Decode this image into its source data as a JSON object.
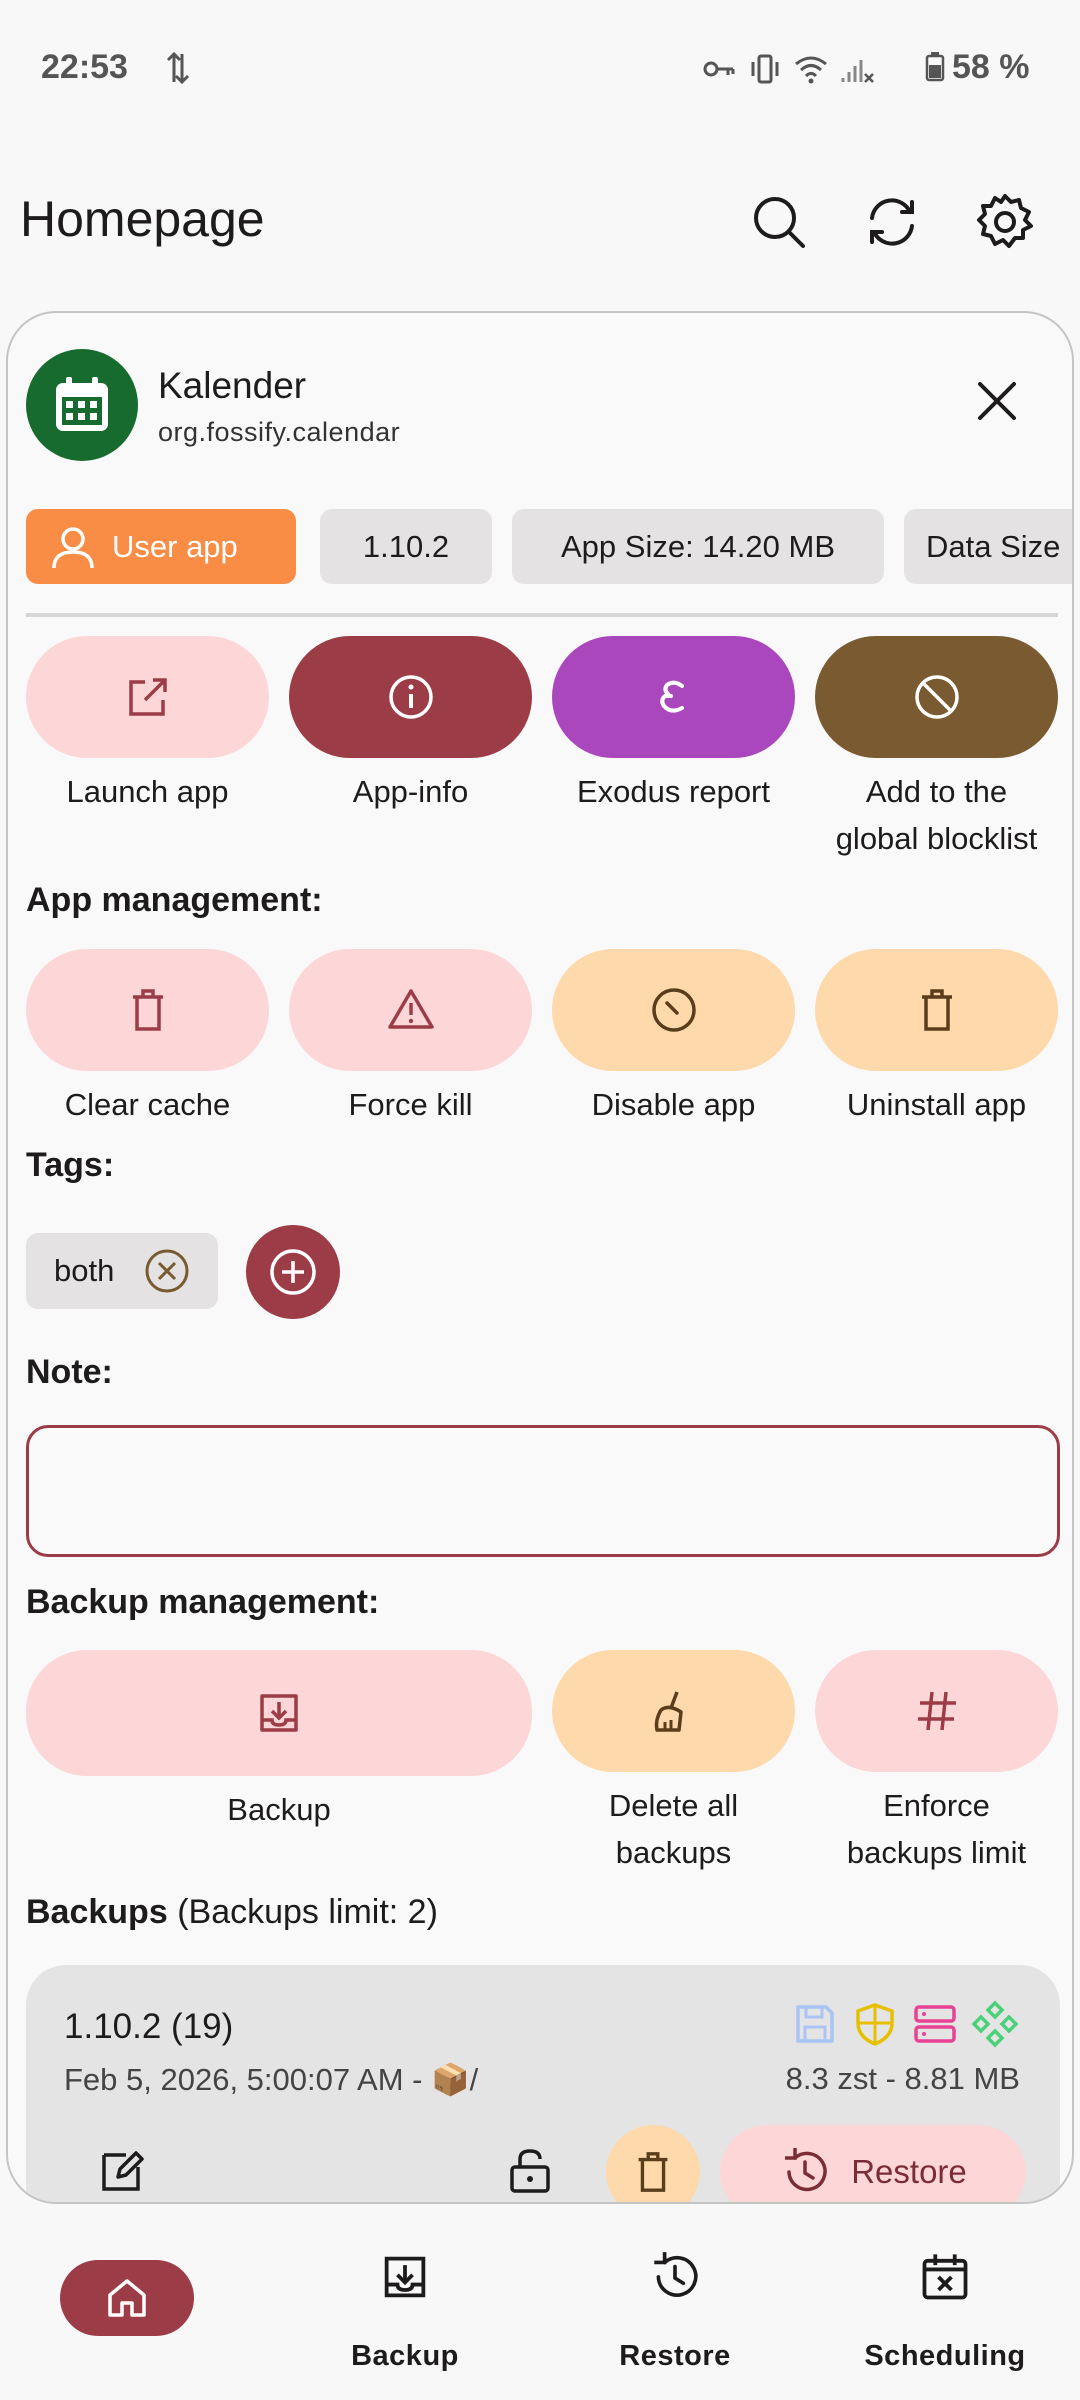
{
  "status_bar": {
    "time": "22:53",
    "battery": "58 %"
  },
  "header": {
    "title": "Homepage"
  },
  "app": {
    "name": "Kalender",
    "package": "org.fossify.calendar"
  },
  "chips": {
    "user_app": "User app",
    "version": "1.10.2",
    "app_size": "App Size: 14.20 MB",
    "data_size": "Data Size"
  },
  "actions": {
    "launch": "Launch app",
    "app_info": "App-info",
    "exodus": "Exodus report",
    "blocklist_line1": "Add to the",
    "blocklist_line2": "global blocklist"
  },
  "app_management": {
    "title": "App management:",
    "clear_cache": "Clear cache",
    "force_kill": "Force kill",
    "disable": "Disable app",
    "uninstall": "Uninstall app"
  },
  "tags": {
    "title": "Tags:",
    "items": [
      "both"
    ]
  },
  "note": {
    "title": "Note:",
    "value": ""
  },
  "backup_management": {
    "title": "Backup management:",
    "backup": "Backup",
    "delete_line1": "Delete all",
    "delete_line2": "backups",
    "enforce_line1": "Enforce",
    "enforce_line2": "backups limit"
  },
  "backups": {
    "title": "Backups",
    "limit": "(Backups limit: 2)",
    "items": [
      {
        "version": "1.10.2 (19)",
        "date": "Feb 5, 2026, 5:00:07 AM - 📦/",
        "size": "8.3 zst - 8.81 MB",
        "restore_label": "Restore"
      }
    ]
  },
  "nav": {
    "home": "",
    "backup": "Backup",
    "restore": "Restore",
    "scheduling": "Scheduling"
  },
  "colors": {
    "primary": "#9b3c46",
    "pink": "#fdd7d8",
    "peach": "#fed9ac",
    "purple": "#ab47bc",
    "brown": "#7a5a30",
    "orange": "#fa8d45",
    "green": "#176b2e"
  }
}
